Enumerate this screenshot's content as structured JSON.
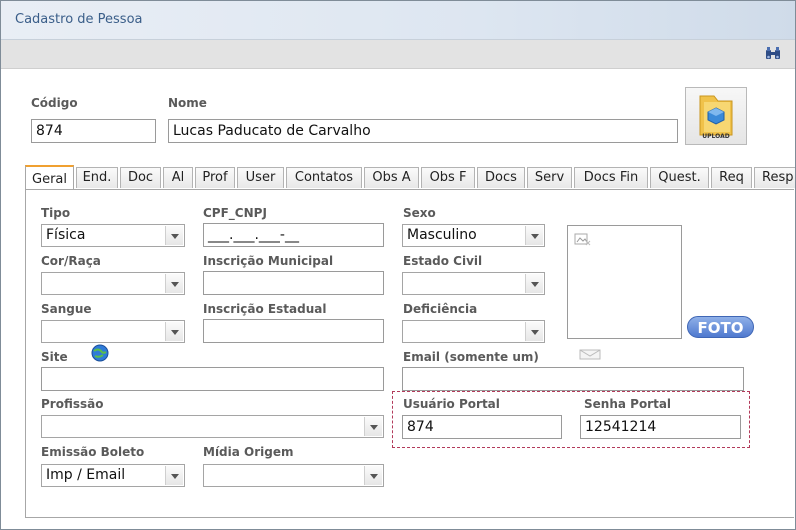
{
  "window": {
    "title": "Cadastro de Pessoa"
  },
  "toolbar": {
    "search_icon": "binoculars-icon"
  },
  "header": {
    "codigo_label": "Código",
    "codigo_value": "874",
    "nome_label": "Nome",
    "nome_value": "Lucas Paducato de Carvalho",
    "upload_label": "UPLOAD"
  },
  "tabs": [
    "Geral",
    "End.",
    "Doc",
    "Al",
    "Prof",
    "User",
    "Contatos",
    "Obs A",
    "Obs F",
    "Docs",
    "Serv",
    "Docs Fin",
    "Quest.",
    "Req",
    "Resp"
  ],
  "form": {
    "tipo_label": "Tipo",
    "tipo_value": "Física",
    "cpf_label": "CPF_CNPJ",
    "cpf_value": "___.___.___-__",
    "sexo_label": "Sexo",
    "sexo_value": "Masculino",
    "cor_label": "Cor/Raça",
    "cor_value": "",
    "insc_mun_label": "Inscrição Municipal",
    "insc_mun_value": "",
    "estado_civil_label": "Estado Civil",
    "estado_civil_value": "",
    "sangue_label": "Sangue",
    "sangue_value": "",
    "insc_est_label": "Inscrição Estadual",
    "insc_est_value": "",
    "deficiencia_label": "Deficiência",
    "deficiencia_value": "",
    "site_label": "Site",
    "site_value": "",
    "email_label": "Email (somente um)",
    "email_value": "",
    "profissao_label": "Profissão",
    "profissao_value": "",
    "usuario_portal_label": "Usuário Portal",
    "usuario_portal_value": "874",
    "senha_portal_label": "Senha Portal",
    "senha_portal_value": "12541214",
    "emissao_label": "Emissão Boleto",
    "emissao_value": "Imp / Email",
    "midia_label": "Mídia Origem",
    "midia_value": ""
  },
  "photo": {
    "button_label": "FOTO"
  },
  "colors": {
    "title_text": "#3a5e89",
    "tab_accent": "#f0a030",
    "foto_button": "#5a82d2",
    "portal_border": "#b23a5a"
  }
}
